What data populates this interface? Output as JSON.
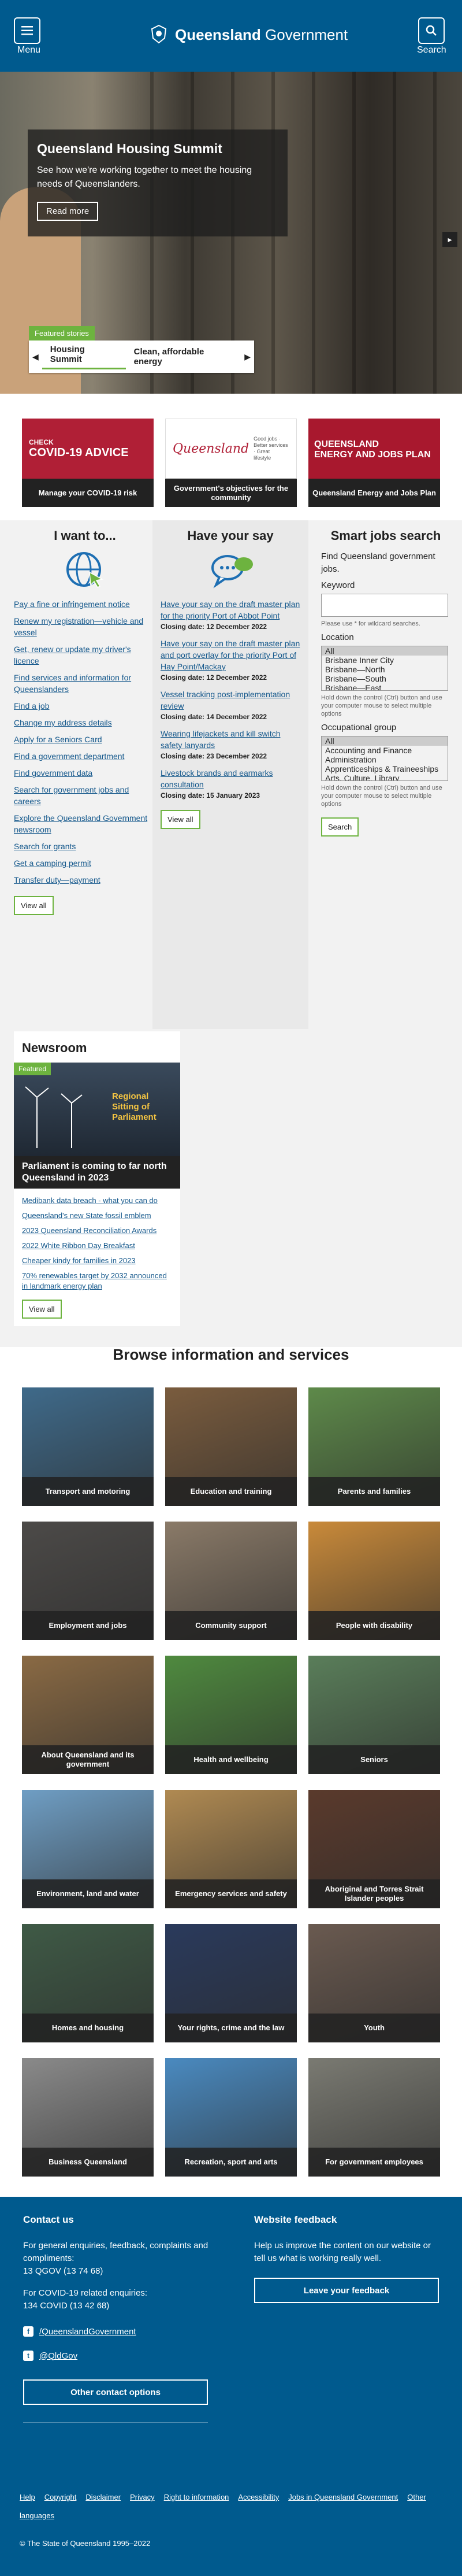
{
  "header": {
    "menu_label": "Menu",
    "search_label": "Search",
    "logo_text_bold": "Queensland",
    "logo_text_regular": "Government"
  },
  "hero": {
    "title": "Queensland Housing Summit",
    "text": "See how we're working together to meet the housing needs of Queenslanders.",
    "read_more": "Read more",
    "featured_tag": "Featured stories",
    "tabs": [
      "Housing Summit",
      "Clean, affordable energy"
    ]
  },
  "promos": [
    {
      "caption": "Manage your COVID-19 risk",
      "img_line1": "CHECK",
      "img_line2": "COVID-19 ADVICE"
    },
    {
      "caption": "Government's objectives for the community",
      "img_line1": "Queensland",
      "img_line2": "Good jobs · Better services · Great lifestyle"
    },
    {
      "caption": "Queensland Energy and Jobs Plan",
      "img_line1": "QUEENSLAND",
      "img_line2": "ENERGY AND JOBS PLAN"
    }
  ],
  "iwant": {
    "title": "I want to...",
    "links": [
      "Pay a fine or infringement notice",
      "Renew my registration—vehicle and vessel",
      "Get, renew or update my driver's licence",
      "Find services and information for Queenslanders",
      "Find a job",
      "Change my address details",
      "Apply for a Seniors Card",
      "Find a government department",
      "Find government data",
      "Search for government jobs and careers",
      "Explore the Queensland Government newsroom",
      "Search for grants",
      "Get a camping permit",
      "Transfer duty—payment"
    ],
    "view_all": "View all"
  },
  "haveyoursay": {
    "title": "Have your say",
    "items": [
      {
        "link": "Have your say on the draft master plan for the priority Port of Abbot Point",
        "closing": "Closing date: 12 December 2022"
      },
      {
        "link": "Have your say on the draft master plan and port overlay for the priority Port of Hay Point/Mackay",
        "closing": "Closing date: 12 December 2022"
      },
      {
        "link": "Vessel tracking post-implementation review",
        "closing": "Closing date: 14 December 2022"
      },
      {
        "link": "Wearing lifejackets and kill switch safety lanyards",
        "closing": "Closing date: 23 December 2022"
      },
      {
        "link": "Livestock brands and earmarks consultation",
        "closing": "Closing date: 15 January 2023"
      }
    ],
    "view_all": "View all"
  },
  "jobs": {
    "title": "Smart jobs search",
    "intro": "Find Queensland government jobs.",
    "keyword_label": "Keyword",
    "keyword_hint": "Please use * for wildcard searches.",
    "location_label": "Location",
    "location_options": [
      "All",
      "Brisbane Inner City",
      "Brisbane—North",
      "Brisbane—South",
      "Brisbane—East"
    ],
    "select_hint": "Hold down the control (Ctrl) button and use your computer mouse to select multiple options",
    "occupation_label": "Occupational group",
    "occupation_options": [
      "All",
      "Accounting and Finance",
      "Administration",
      "Apprenticeships & Traineeships",
      "Arts, Culture, Library"
    ],
    "search_button": "Search"
  },
  "newsroom": {
    "title": "Newsroom",
    "featured": "Featured",
    "image_text": "Regional Sitting of Parliament",
    "headline": "Parliament is coming to far north Queensland in 2023",
    "links": [
      "Medibank data breach - what you can do",
      "Queensland's new State fossil emblem",
      "2023 Queensland Reconciliation Awards",
      "2022 White Ribbon Day Breakfast",
      "Cheaper kindy for families in 2023",
      "70% renewables target by 2032 announced in landmark energy plan"
    ],
    "view_all": "View all"
  },
  "browse": {
    "title": "Browse information and services",
    "tiles": [
      "Transport and motoring",
      "Education and training",
      "Parents and families",
      "Employment and jobs",
      "Community support",
      "People with disability",
      "About Queensland and its government",
      "Health and wellbeing",
      "Seniors",
      "Environment, land and water",
      "Emergency services and safety",
      "Aboriginal and Torres Strait Islander peoples",
      "Homes and housing",
      "Your rights, crime and the law",
      "Youth",
      "Business Queensland",
      "Recreation, sport and arts",
      "For government employees"
    ],
    "tile_colors": [
      "#3f6a8a",
      "#7a5c3e",
      "#5e8a4a",
      "#4c4a48",
      "#8a7a68",
      "#c98a3a",
      "#8a6a44",
      "#4f8a3f",
      "#5a7e5a",
      "#6f9ec4",
      "#b08a52",
      "#5a3a2c",
      "#3f5a46",
      "#2a3a5c",
      "#6a5a50",
      "#8a8a8a",
      "#4a8ac0",
      "#7a7a72"
    ]
  },
  "footer": {
    "contact_title": "Contact us",
    "contact_text": "For general enquiries, feedback, complaints and compliments:",
    "contact_phone": "13 QGOV (13 74 68)",
    "covid_text": "For COVID-19 related enquiries:",
    "covid_phone": "134 COVID (13 42 68)",
    "facebook": "/QueenslandGovernment",
    "twitter": "@QldGov",
    "other_contact": "Other contact options",
    "feedback_title": "Website feedback",
    "feedback_text": "Help us improve the content on our website or tell us what is working really well.",
    "feedback_button": "Leave your feedback",
    "links": [
      "Help",
      "Copyright",
      "Disclaimer",
      "Privacy",
      "Right to information",
      "Accessibility",
      "Jobs in Queensland Government",
      "Other languages"
    ],
    "copyright": "© The State of Queensland 1995–2022"
  }
}
